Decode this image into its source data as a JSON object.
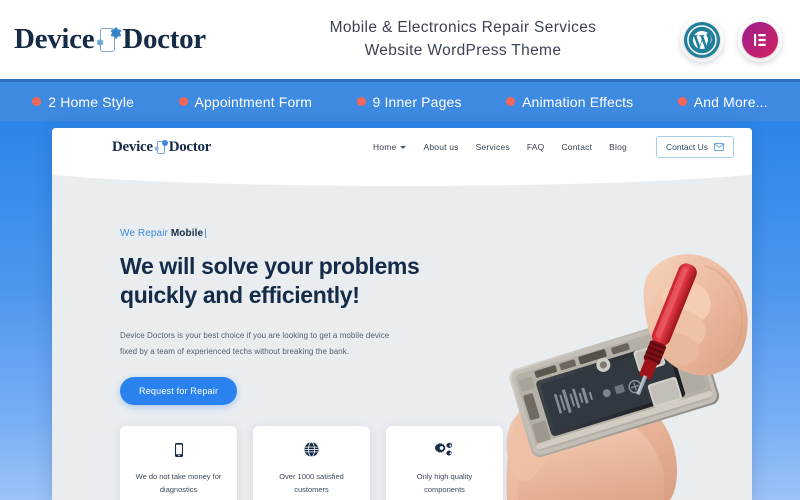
{
  "header": {
    "logo": {
      "word1": "Device",
      "word2": "Doctor",
      "mark_icon": "phone-gear-icon"
    },
    "title_line1": "Mobile & Electronics Repair Services",
    "title_line2": "Website WordPress Theme",
    "badges": [
      {
        "name": "wordpress-badge",
        "glyph": "W",
        "color": "#227f9a"
      },
      {
        "name": "elementor-badge",
        "glyph": "E",
        "color": "#d6215f"
      }
    ]
  },
  "feature_bar": {
    "bg_color": "#3d8ae0",
    "dot_color": "#f4655a",
    "items": [
      {
        "label": "2 Home Style"
      },
      {
        "label": "Appointment Form"
      },
      {
        "label": "9 Inner Pages"
      },
      {
        "label": "Animation Effects"
      },
      {
        "label": "And More..."
      }
    ]
  },
  "mockup": {
    "nav": {
      "logo": {
        "word1": "Device",
        "word2": "Doctor"
      },
      "menu": [
        {
          "label": "Home",
          "has_dropdown": true
        },
        {
          "label": "About us",
          "has_dropdown": false
        },
        {
          "label": "Services",
          "has_dropdown": false
        },
        {
          "label": "FAQ",
          "has_dropdown": false
        },
        {
          "label": "Contact",
          "has_dropdown": false
        },
        {
          "label": "Blog",
          "has_dropdown": false
        }
      ],
      "contact_button": {
        "label": "Contact Us",
        "icon": "envelope-icon"
      }
    },
    "hero": {
      "eyebrow_prefix": "We Repair",
      "eyebrow_typed": "Mobile",
      "eyebrow_cursor": "|",
      "title_line1": "We will solve your problems",
      "title_line2": "quickly and efficiently!",
      "description_line1": "Device Doctors is your best choice if you are looking to get a mobile device",
      "description_line2": "fixed by a team of experienced techs without breaking the bank.",
      "cta_label": "Request for Repair",
      "photo_alt": "hand-holding-disassembled-phone-with-red-screwdriver",
      "accent_color": "#2a82ef"
    },
    "cards": [
      {
        "icon": "mobile-phone-icon",
        "line1": "We do not take money for",
        "line2": "diagnostics"
      },
      {
        "icon": "globe-icon",
        "line1": "Over 1000 satisfied",
        "line2": "customers"
      },
      {
        "icon": "gears-icon",
        "line1": "Only high quality",
        "line2": "components"
      }
    ]
  }
}
